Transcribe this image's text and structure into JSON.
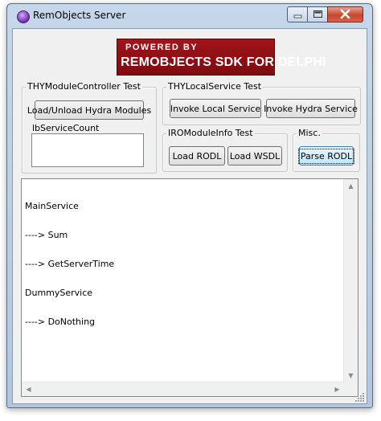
{
  "window": {
    "title": "RemObjects Server"
  },
  "banner": {
    "line1": "POWERED BY",
    "line2": "REMOBJECTS SDK FOR DELPHI"
  },
  "groups": {
    "module_controller": {
      "label": "THYModuleController Test",
      "button": "Load/Unload Hydra Modules"
    },
    "local_service": {
      "label": "THYLocalService Test",
      "invoke_local": "Invoke Local Service",
      "invoke_hydra": "Invoke Hydra Service"
    },
    "module_info": {
      "label": "IROModuleInfo Test",
      "load_rodl": "Load RODL",
      "load_wsdl": "Load WSDL"
    },
    "misc": {
      "label": "Misc.",
      "parse_rodl": "Parse RODL"
    }
  },
  "service_count": {
    "label": "lbServiceCount"
  },
  "output": {
    "lines": [
      "MainService",
      "----> Sum",
      "----> GetServerTime",
      "DummyService",
      "----> DoNothing"
    ]
  },
  "icons": {
    "app": "remobjects-app-icon",
    "minimize": "minimize-icon",
    "maximize": "maximize-icon",
    "close": "close-icon"
  }
}
